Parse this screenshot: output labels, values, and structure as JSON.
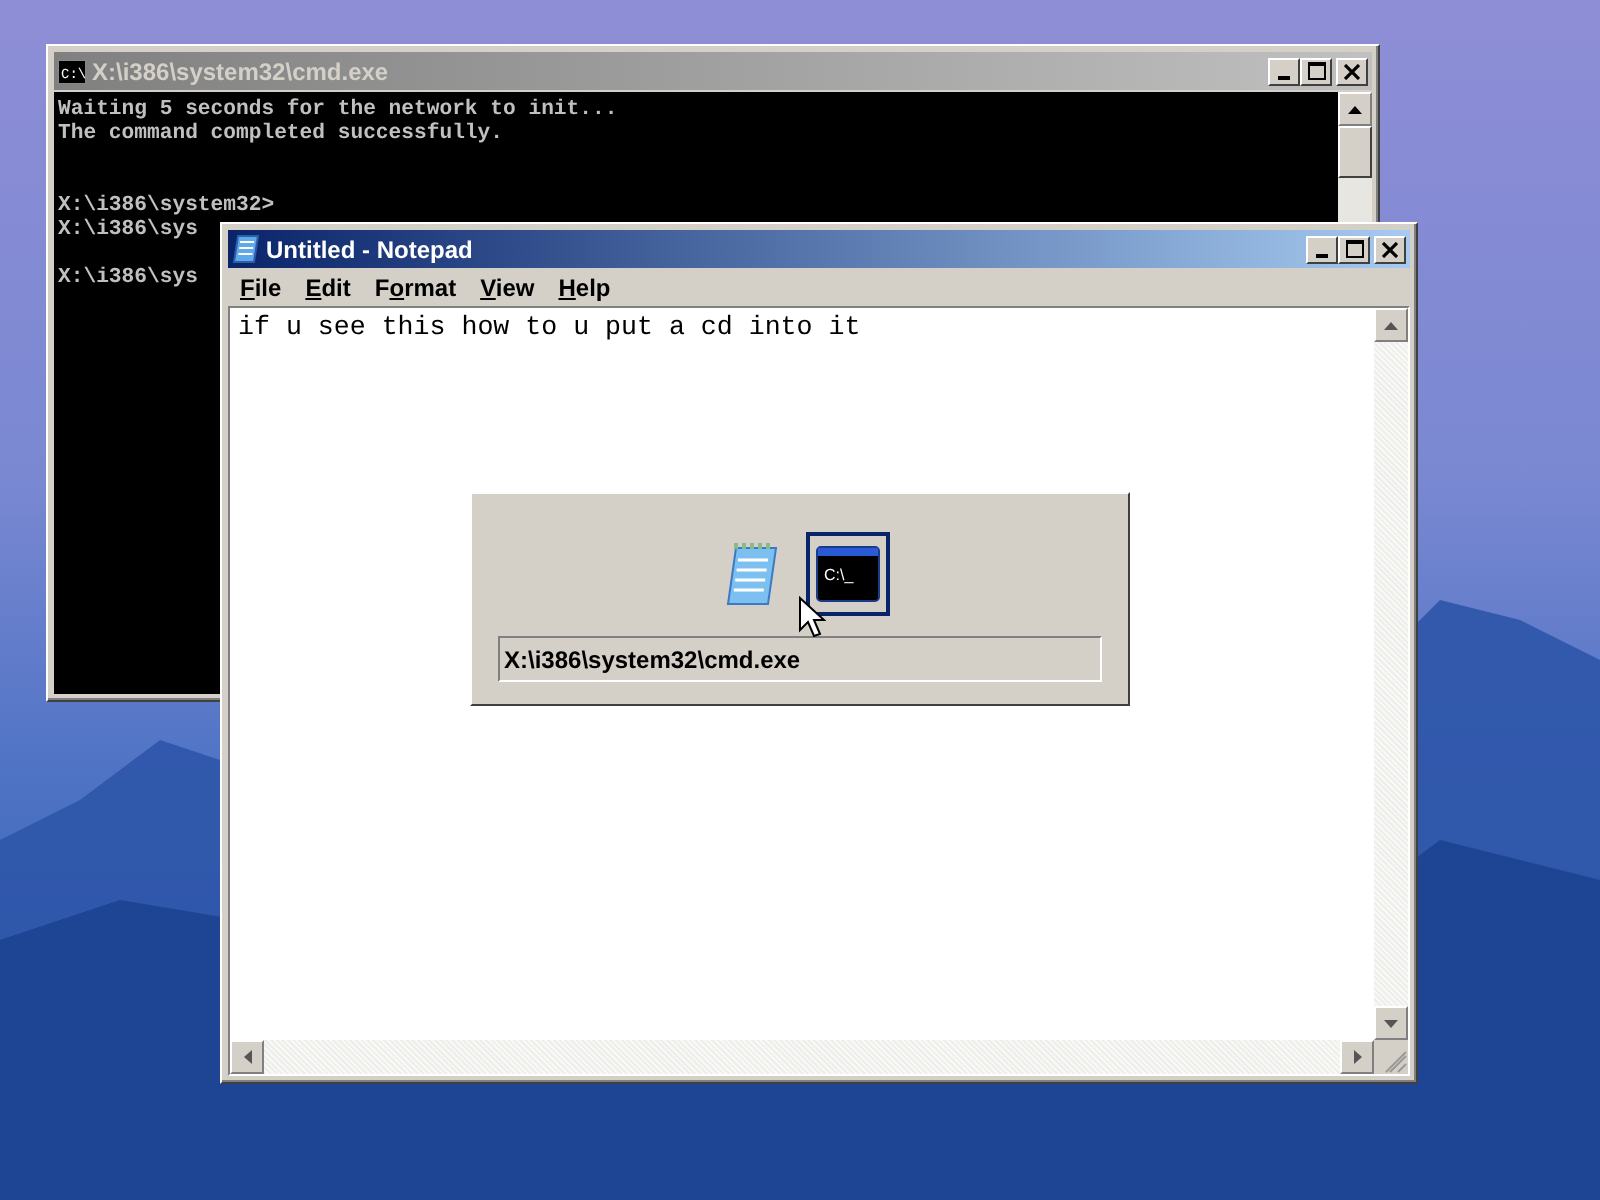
{
  "console_window": {
    "title": "X:\\i386\\system32\\cmd.exe",
    "active": false,
    "icon_text": "C:\\",
    "blocks": [
      [
        "Waiting 5 seconds for the network to init...",
        "The command completed successfully."
      ],
      [
        "X:\\i386\\system32>",
        "X:\\i386\\sys"
      ],
      [
        "X:\\i386\\sys"
      ]
    ]
  },
  "notepad_window": {
    "title": "Untitled - Notepad",
    "active": true,
    "menu": [
      {
        "access_key": "F",
        "rest": "ile"
      },
      {
        "access_key": "E",
        "rest": "dit"
      },
      {
        "lead": "F",
        "access_key": "o",
        "rest": "rmat"
      },
      {
        "access_key": "V",
        "rest": "iew"
      },
      {
        "access_key": "H",
        "rest": "elp"
      }
    ],
    "text": "if u see this how to u put a cd into it"
  },
  "task_switcher": {
    "items": [
      {
        "kind": "notepad",
        "selected": false
      },
      {
        "kind": "console",
        "selected": true,
        "icon_text": "C:\\_"
      }
    ],
    "caption": "X:\\i386\\system32\\cmd.exe"
  }
}
